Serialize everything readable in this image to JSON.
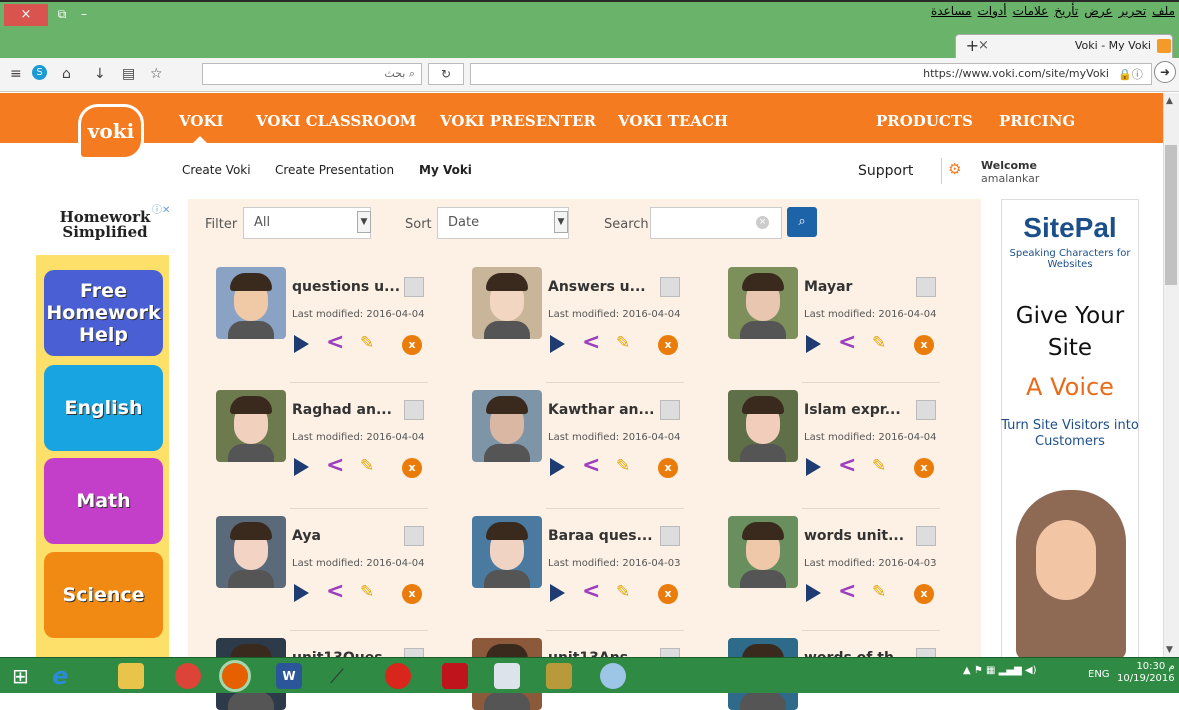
{
  "browser": {
    "menu": [
      "ملف",
      "تحرير",
      "عرض",
      "تأريخ",
      "علامات",
      "أدوات",
      "مساعدة"
    ],
    "tab_title": "Voki - My Voki",
    "search_placeholder": "بحث",
    "url": "https://www.voki.com/site/myVoki",
    "close_glyph": "×",
    "newtab_glyph": "+"
  },
  "site": {
    "logo": "voki",
    "nav": [
      "VOKI",
      "VOKI CLASSROOM",
      "VOKI PRESENTER",
      "VOKI TEACH",
      "PRODUCTS",
      "PRICING"
    ],
    "subnav": [
      "Create Voki",
      "Create Presentation",
      "My Voki"
    ],
    "support": "Support",
    "welcome": "Welcome",
    "username": "amalankar"
  },
  "toolbar": {
    "filter_label": "Filter",
    "filter_value": "All",
    "sort_label": "Sort",
    "sort_value": "Date",
    "search_label": "Search"
  },
  "cards": [
    {
      "title": "questions u...",
      "modified": "Last modified: 2016-04-04"
    },
    {
      "title": "Answers u...",
      "modified": "Last modified: 2016-04-04"
    },
    {
      "title": "Mayar",
      "modified": "Last modified: 2016-04-04"
    },
    {
      "title": "Raghad an...",
      "modified": "Last modified: 2016-04-04"
    },
    {
      "title": "Kawthar an...",
      "modified": "Last modified: 2016-04-04"
    },
    {
      "title": "Islam expr...",
      "modified": "Last modified: 2016-04-04"
    },
    {
      "title": "Aya",
      "modified": "Last modified: 2016-04-04"
    },
    {
      "title": "Baraa ques...",
      "modified": "Last modified: 2016-04-03"
    },
    {
      "title": "words unit...",
      "modified": "Last modified: 2016-04-03"
    },
    {
      "title": "unit13Ques...",
      "modified": ""
    },
    {
      "title": "unit13Ans...",
      "modified": ""
    },
    {
      "title": "words of th...",
      "modified": ""
    }
  ],
  "ad_left": {
    "brand": "Homework Simplified",
    "buttons": [
      {
        "label": "Free Homework Help",
        "color": "#4a5fd4"
      },
      {
        "label": "English",
        "color": "#18a4e0"
      },
      {
        "label": "Math",
        "color": "#c43fc9"
      },
      {
        "label": "Science",
        "color": "#f08a12"
      }
    ]
  },
  "ad_right": {
    "brand": "SitePal",
    "tagline": "Speaking Characters for Websites",
    "line1": "Give Your Site",
    "line2": "A Voice",
    "line3": "Turn Site Visitors into Customers"
  },
  "taskbar": {
    "lang": "ENG",
    "time": "10:30 م",
    "date": "10/19/2016"
  }
}
